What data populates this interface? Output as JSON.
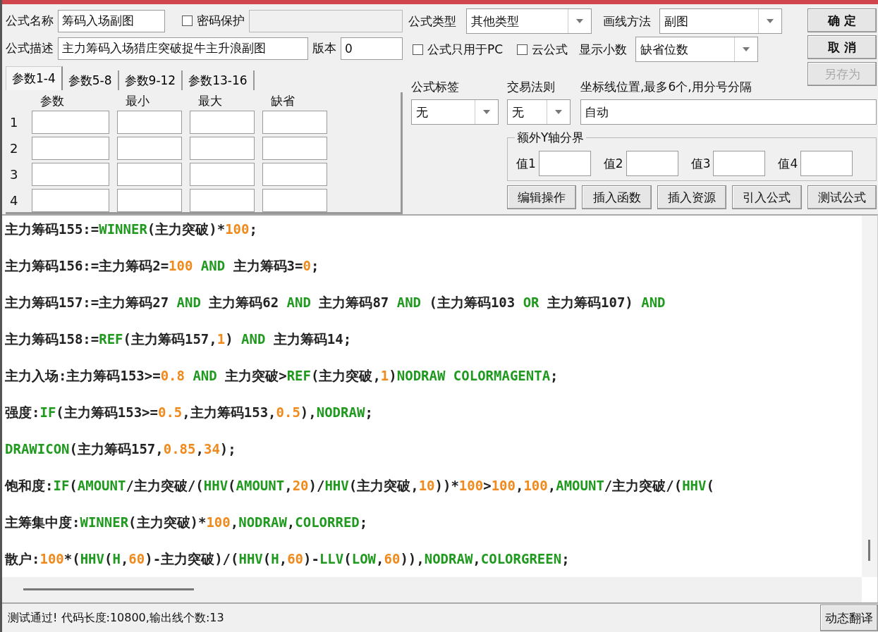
{
  "formula_name": {
    "label": "公式名称",
    "value": "筹码入场副图"
  },
  "password_protect": {
    "label": "密码保护",
    "checked": false
  },
  "description": {
    "label": "公式描述",
    "value": "主力筹码入场猎庄突破捉牛主升浪副图"
  },
  "version": {
    "label": "版本",
    "value": "0"
  },
  "param_tabs": [
    {
      "label": "参数1-4",
      "selected": true
    },
    {
      "label": "参数5-8",
      "selected": false
    },
    {
      "label": "参数9-12",
      "selected": false
    },
    {
      "label": "参数13-16",
      "selected": false
    }
  ],
  "param_columns": [
    "参数",
    "最小",
    "最大",
    "缺省"
  ],
  "param_rows": [
    "1",
    "2",
    "3",
    "4"
  ],
  "formula_type": {
    "label": "公式类型",
    "value": "其他类型"
  },
  "draw_method": {
    "label": "画线方法",
    "value": "副图"
  },
  "pc_only": {
    "label": "公式只用于PC",
    "checked": false
  },
  "cloud_formula": {
    "label": "云公式",
    "checked": false
  },
  "decimals": {
    "label": "显示小数",
    "value": "缺省位数"
  },
  "side_buttons": [
    {
      "label": "确 定",
      "disabled": false
    },
    {
      "label": "取 消",
      "disabled": false
    },
    {
      "label": "另存为",
      "disabled": true
    }
  ],
  "formula_tag": {
    "label": "公式标签",
    "value": "无"
  },
  "trade_rule": {
    "label": "交易法则",
    "value": "无"
  },
  "axis_lines": {
    "label": "坐标线位置,最多6个,用分号分隔",
    "value": "自动"
  },
  "extra_y_axis": {
    "title": "额外Y轴分界",
    "fields": [
      "值1",
      "值2",
      "值3",
      "值4"
    ]
  },
  "action_buttons": [
    "编辑操作",
    "插入函数",
    "插入资源",
    "引入公式",
    "测试公式"
  ],
  "code_lines": [
    [
      {
        "kind": "plain",
        "text": "主力筹码155:="
      },
      {
        "kind": "keyword",
        "text": "WINNER"
      },
      {
        "kind": "plain",
        "text": "(主力突破)*"
      },
      {
        "kind": "number",
        "text": "100"
      },
      {
        "kind": "plain",
        "text": ";"
      }
    ],
    [
      {
        "kind": "plain",
        "text": "主力筹码156:=主力筹码2="
      },
      {
        "kind": "number",
        "text": "100"
      },
      {
        "kind": "keyword",
        "text": " AND"
      },
      {
        "kind": "plain",
        "text": " 主力筹码3="
      },
      {
        "kind": "number",
        "text": "0"
      },
      {
        "kind": "plain",
        "text": ";"
      }
    ],
    [
      {
        "kind": "plain",
        "text": "主力筹码157:=主力筹码27 "
      },
      {
        "kind": "keyword",
        "text": "AND"
      },
      {
        "kind": "plain",
        "text": " 主力筹码62 "
      },
      {
        "kind": "keyword",
        "text": "AND"
      },
      {
        "kind": "plain",
        "text": " 主力筹码87 "
      },
      {
        "kind": "keyword",
        "text": "AND"
      },
      {
        "kind": "plain",
        "text": " (主力筹码103 "
      },
      {
        "kind": "keyword",
        "text": "OR"
      },
      {
        "kind": "plain",
        "text": " 主力筹码107) "
      },
      {
        "kind": "keyword",
        "text": "AND"
      }
    ],
    [
      {
        "kind": "plain",
        "text": "主力筹码158:="
      },
      {
        "kind": "keyword",
        "text": "REF"
      },
      {
        "kind": "plain",
        "text": "(主力筹码157,"
      },
      {
        "kind": "number",
        "text": "1"
      },
      {
        "kind": "plain",
        "text": ") "
      },
      {
        "kind": "keyword",
        "text": "AND"
      },
      {
        "kind": "plain",
        "text": " 主力筹码14;"
      }
    ],
    [
      {
        "kind": "plain",
        "text": "主力入场:主力筹码153>="
      },
      {
        "kind": "number",
        "text": "0.8"
      },
      {
        "kind": "keyword",
        "text": " AND"
      },
      {
        "kind": "plain",
        "text": " 主力突破>"
      },
      {
        "kind": "keyword",
        "text": "REF"
      },
      {
        "kind": "plain",
        "text": "(主力突破,"
      },
      {
        "kind": "number",
        "text": "1"
      },
      {
        "kind": "plain",
        "text": ")"
      },
      {
        "kind": "keyword",
        "text": "NODRAW COLORMAGENTA"
      },
      {
        "kind": "plain",
        "text": ";"
      }
    ],
    [
      {
        "kind": "plain",
        "text": "强度:"
      },
      {
        "kind": "keyword",
        "text": "IF"
      },
      {
        "kind": "plain",
        "text": "(主力筹码153>="
      },
      {
        "kind": "number",
        "text": "0.5"
      },
      {
        "kind": "plain",
        "text": ",主力筹码153,"
      },
      {
        "kind": "number",
        "text": "0.5"
      },
      {
        "kind": "plain",
        "text": "),"
      },
      {
        "kind": "keyword",
        "text": "NODRAW"
      },
      {
        "kind": "plain",
        "text": ";"
      }
    ],
    [
      {
        "kind": "keyword",
        "text": "DRAWICON"
      },
      {
        "kind": "plain",
        "text": "(主力筹码157,"
      },
      {
        "kind": "number",
        "text": "0.85"
      },
      {
        "kind": "plain",
        "text": ","
      },
      {
        "kind": "number",
        "text": "34"
      },
      {
        "kind": "plain",
        "text": ");"
      }
    ],
    [
      {
        "kind": "plain",
        "text": "饱和度:"
      },
      {
        "kind": "keyword",
        "text": "IF"
      },
      {
        "kind": "plain",
        "text": "("
      },
      {
        "kind": "keyword",
        "text": "AMOUNT"
      },
      {
        "kind": "plain",
        "text": "/主力突破/("
      },
      {
        "kind": "keyword",
        "text": "HHV"
      },
      {
        "kind": "plain",
        "text": "("
      },
      {
        "kind": "keyword",
        "text": "AMOUNT"
      },
      {
        "kind": "plain",
        "text": ","
      },
      {
        "kind": "number",
        "text": "20"
      },
      {
        "kind": "plain",
        "text": ")/"
      },
      {
        "kind": "keyword",
        "text": "HHV"
      },
      {
        "kind": "plain",
        "text": "(主力突破,"
      },
      {
        "kind": "number",
        "text": "10"
      },
      {
        "kind": "plain",
        "text": "))*"
      },
      {
        "kind": "number",
        "text": "100"
      },
      {
        "kind": "plain",
        "text": ">"
      },
      {
        "kind": "number",
        "text": "100"
      },
      {
        "kind": "plain",
        "text": ","
      },
      {
        "kind": "number",
        "text": "100"
      },
      {
        "kind": "plain",
        "text": ","
      },
      {
        "kind": "keyword",
        "text": "AMOUNT"
      },
      {
        "kind": "plain",
        "text": "/主力突破/("
      },
      {
        "kind": "keyword",
        "text": "HHV"
      },
      {
        "kind": "plain",
        "text": "("
      }
    ],
    [
      {
        "kind": "plain",
        "text": "主筹集中度:"
      },
      {
        "kind": "keyword",
        "text": "WINNER"
      },
      {
        "kind": "plain",
        "text": "(主力突破)*"
      },
      {
        "kind": "number",
        "text": "100"
      },
      {
        "kind": "plain",
        "text": ","
      },
      {
        "kind": "keyword",
        "text": "NODRAW"
      },
      {
        "kind": "plain",
        "text": ","
      },
      {
        "kind": "keyword",
        "text": "COLORRED"
      },
      {
        "kind": "plain",
        "text": ";"
      }
    ],
    [
      {
        "kind": "plain",
        "text": "散户:"
      },
      {
        "kind": "number",
        "text": "100"
      },
      {
        "kind": "plain",
        "text": "*("
      },
      {
        "kind": "keyword",
        "text": "HHV"
      },
      {
        "kind": "plain",
        "text": "("
      },
      {
        "kind": "keyword",
        "text": "H"
      },
      {
        "kind": "plain",
        "text": ","
      },
      {
        "kind": "number",
        "text": "60"
      },
      {
        "kind": "plain",
        "text": ")-主力突破)/("
      },
      {
        "kind": "keyword",
        "text": "HHV"
      },
      {
        "kind": "plain",
        "text": "("
      },
      {
        "kind": "keyword",
        "text": "H"
      },
      {
        "kind": "plain",
        "text": ","
      },
      {
        "kind": "number",
        "text": "60"
      },
      {
        "kind": "plain",
        "text": ")-"
      },
      {
        "kind": "keyword",
        "text": "LLV"
      },
      {
        "kind": "plain",
        "text": "("
      },
      {
        "kind": "keyword",
        "text": "LOW"
      },
      {
        "kind": "plain",
        "text": ","
      },
      {
        "kind": "number",
        "text": "60"
      },
      {
        "kind": "plain",
        "text": ")),"
      },
      {
        "kind": "keyword",
        "text": "NODRAW"
      },
      {
        "kind": "plain",
        "text": ","
      },
      {
        "kind": "keyword",
        "text": "COLORGREEN"
      },
      {
        "kind": "plain",
        "text": ";"
      }
    ]
  ],
  "status_bar": {
    "message": "测试通过! 代码长度:10800,输出线个数:13",
    "button": "动态翻译"
  }
}
